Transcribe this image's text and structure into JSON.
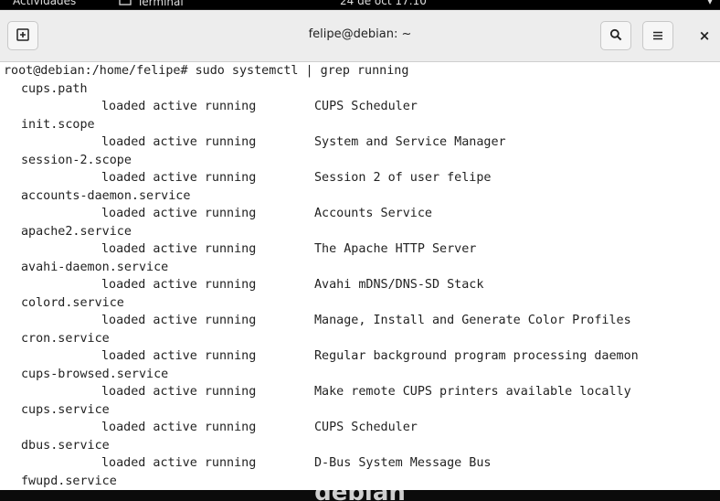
{
  "top_bar": {
    "activities": "Actividades",
    "app_name": "Terminal",
    "clock": "24 de oct 17:10"
  },
  "window": {
    "title": "felipe@debian: ~",
    "close_glyph": "×"
  },
  "terminal": {
    "prompt_line": "root@debian:/home/felipe# sudo systemctl | grep running",
    "units": [
      {
        "name": "cups.path",
        "status": "loaded active running",
        "description": "CUPS Scheduler"
      },
      {
        "name": "init.scope",
        "status": "loaded active running",
        "description": "System and Service Manager"
      },
      {
        "name": "session-2.scope",
        "status": "loaded active running",
        "description": "Session 2 of user felipe"
      },
      {
        "name": "accounts-daemon.service",
        "status": "loaded active running",
        "description": "Accounts Service"
      },
      {
        "name": "apache2.service",
        "status": "loaded active running",
        "description": "The Apache HTTP Server"
      },
      {
        "name": "avahi-daemon.service",
        "status": "loaded active running",
        "description": "Avahi mDNS/DNS-SD Stack"
      },
      {
        "name": "colord.service",
        "status": "loaded active running",
        "description": "Manage, Install and Generate Color Profiles"
      },
      {
        "name": "cron.service",
        "status": "loaded active running",
        "description": "Regular background program processing daemon"
      },
      {
        "name": "cups-browsed.service",
        "status": "loaded active running",
        "description": "Make remote CUPS printers available locally"
      },
      {
        "name": "cups.service",
        "status": "loaded active running",
        "description": "CUPS Scheduler"
      },
      {
        "name": "dbus.service",
        "status": "loaded active running",
        "description": "D-Bus System Message Bus"
      },
      {
        "name": "fwupd.service"
      }
    ]
  },
  "dock": {
    "wallpaper_text": "debian"
  },
  "icons": {
    "new_tab": "new-tab-icon",
    "search": "search-icon",
    "menu": "hamburger-menu-icon",
    "close": "close-icon"
  }
}
